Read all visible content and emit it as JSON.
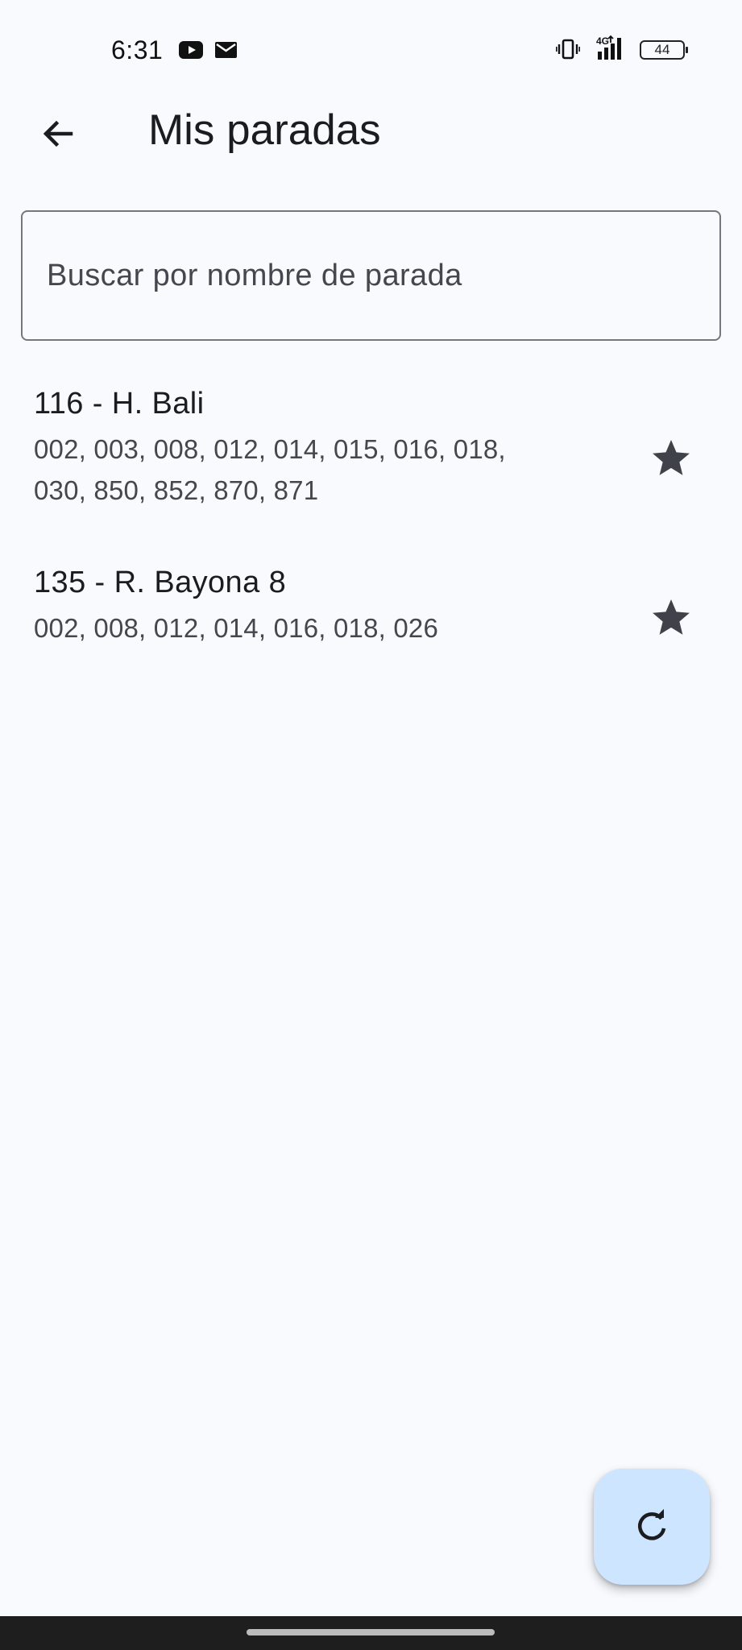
{
  "status_bar": {
    "time": "6:31",
    "icons": [
      "youtube-icon",
      "mail-icon",
      "vibrate-icon",
      "signal-4g-icon",
      "battery-icon"
    ],
    "network": "4G",
    "battery": "44"
  },
  "app_bar": {
    "title": "Mis paradas",
    "back_icon": "arrow-left-icon"
  },
  "search": {
    "placeholder": "Buscar por nombre de parada",
    "value": ""
  },
  "stops": [
    {
      "title": "116 - H. Bali",
      "lines": "002, 003, 008, 012, 014, 015, 016, 018, 030, 850, 852, 870, 871",
      "favorite": true
    },
    {
      "title": "135 - R. Bayona 8",
      "lines": "002, 008, 012, 014, 016, 018, 026",
      "favorite": true
    }
  ],
  "fab": {
    "icon": "refresh-icon",
    "color": "#cde5ff"
  },
  "colors": {
    "background": "#f9fafe",
    "text_primary": "#1b1c1f",
    "text_secondary": "#44474e",
    "icon": "#3f4349",
    "outline": "#74777f"
  }
}
